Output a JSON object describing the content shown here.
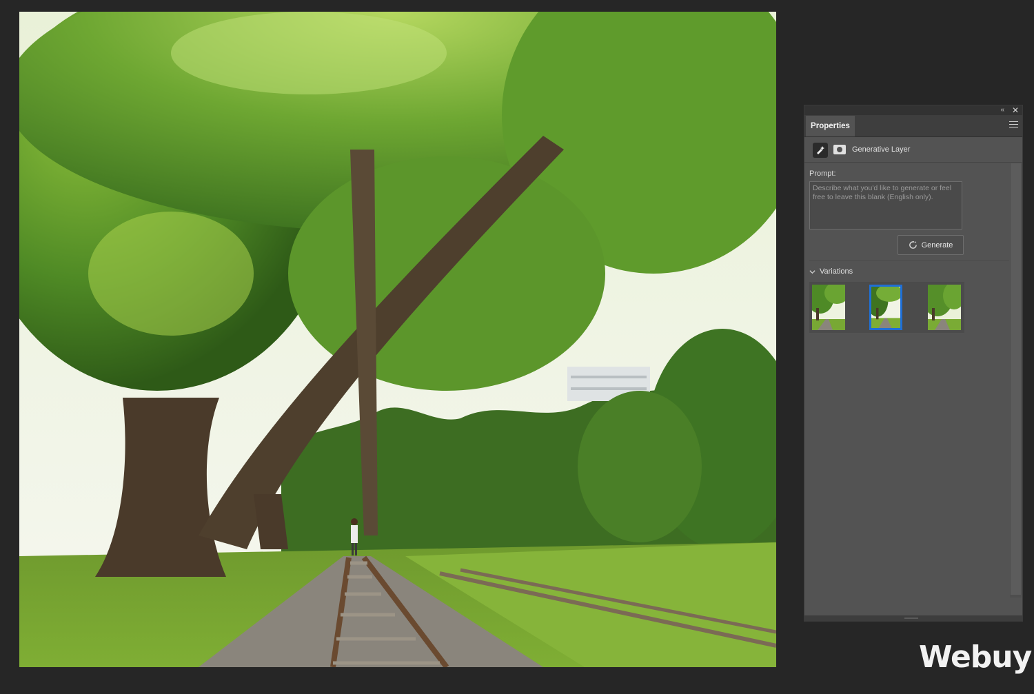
{
  "panel": {
    "tab_label": "Properties",
    "collapse_glyph": "«",
    "close_glyph": "✕",
    "layer": {
      "name": "Generative Layer",
      "icon": "generative-layer-icon",
      "mask_icon": "layer-mask-icon"
    },
    "prompt": {
      "label": "Prompt:",
      "value": "",
      "placeholder": "Describe what you'd like to generate or feel free to leave this blank (English only)."
    },
    "generate_label": "Generate",
    "variations": {
      "label": "Variations",
      "selected_index": 1,
      "count": 3
    }
  },
  "watermark": "Webuy"
}
